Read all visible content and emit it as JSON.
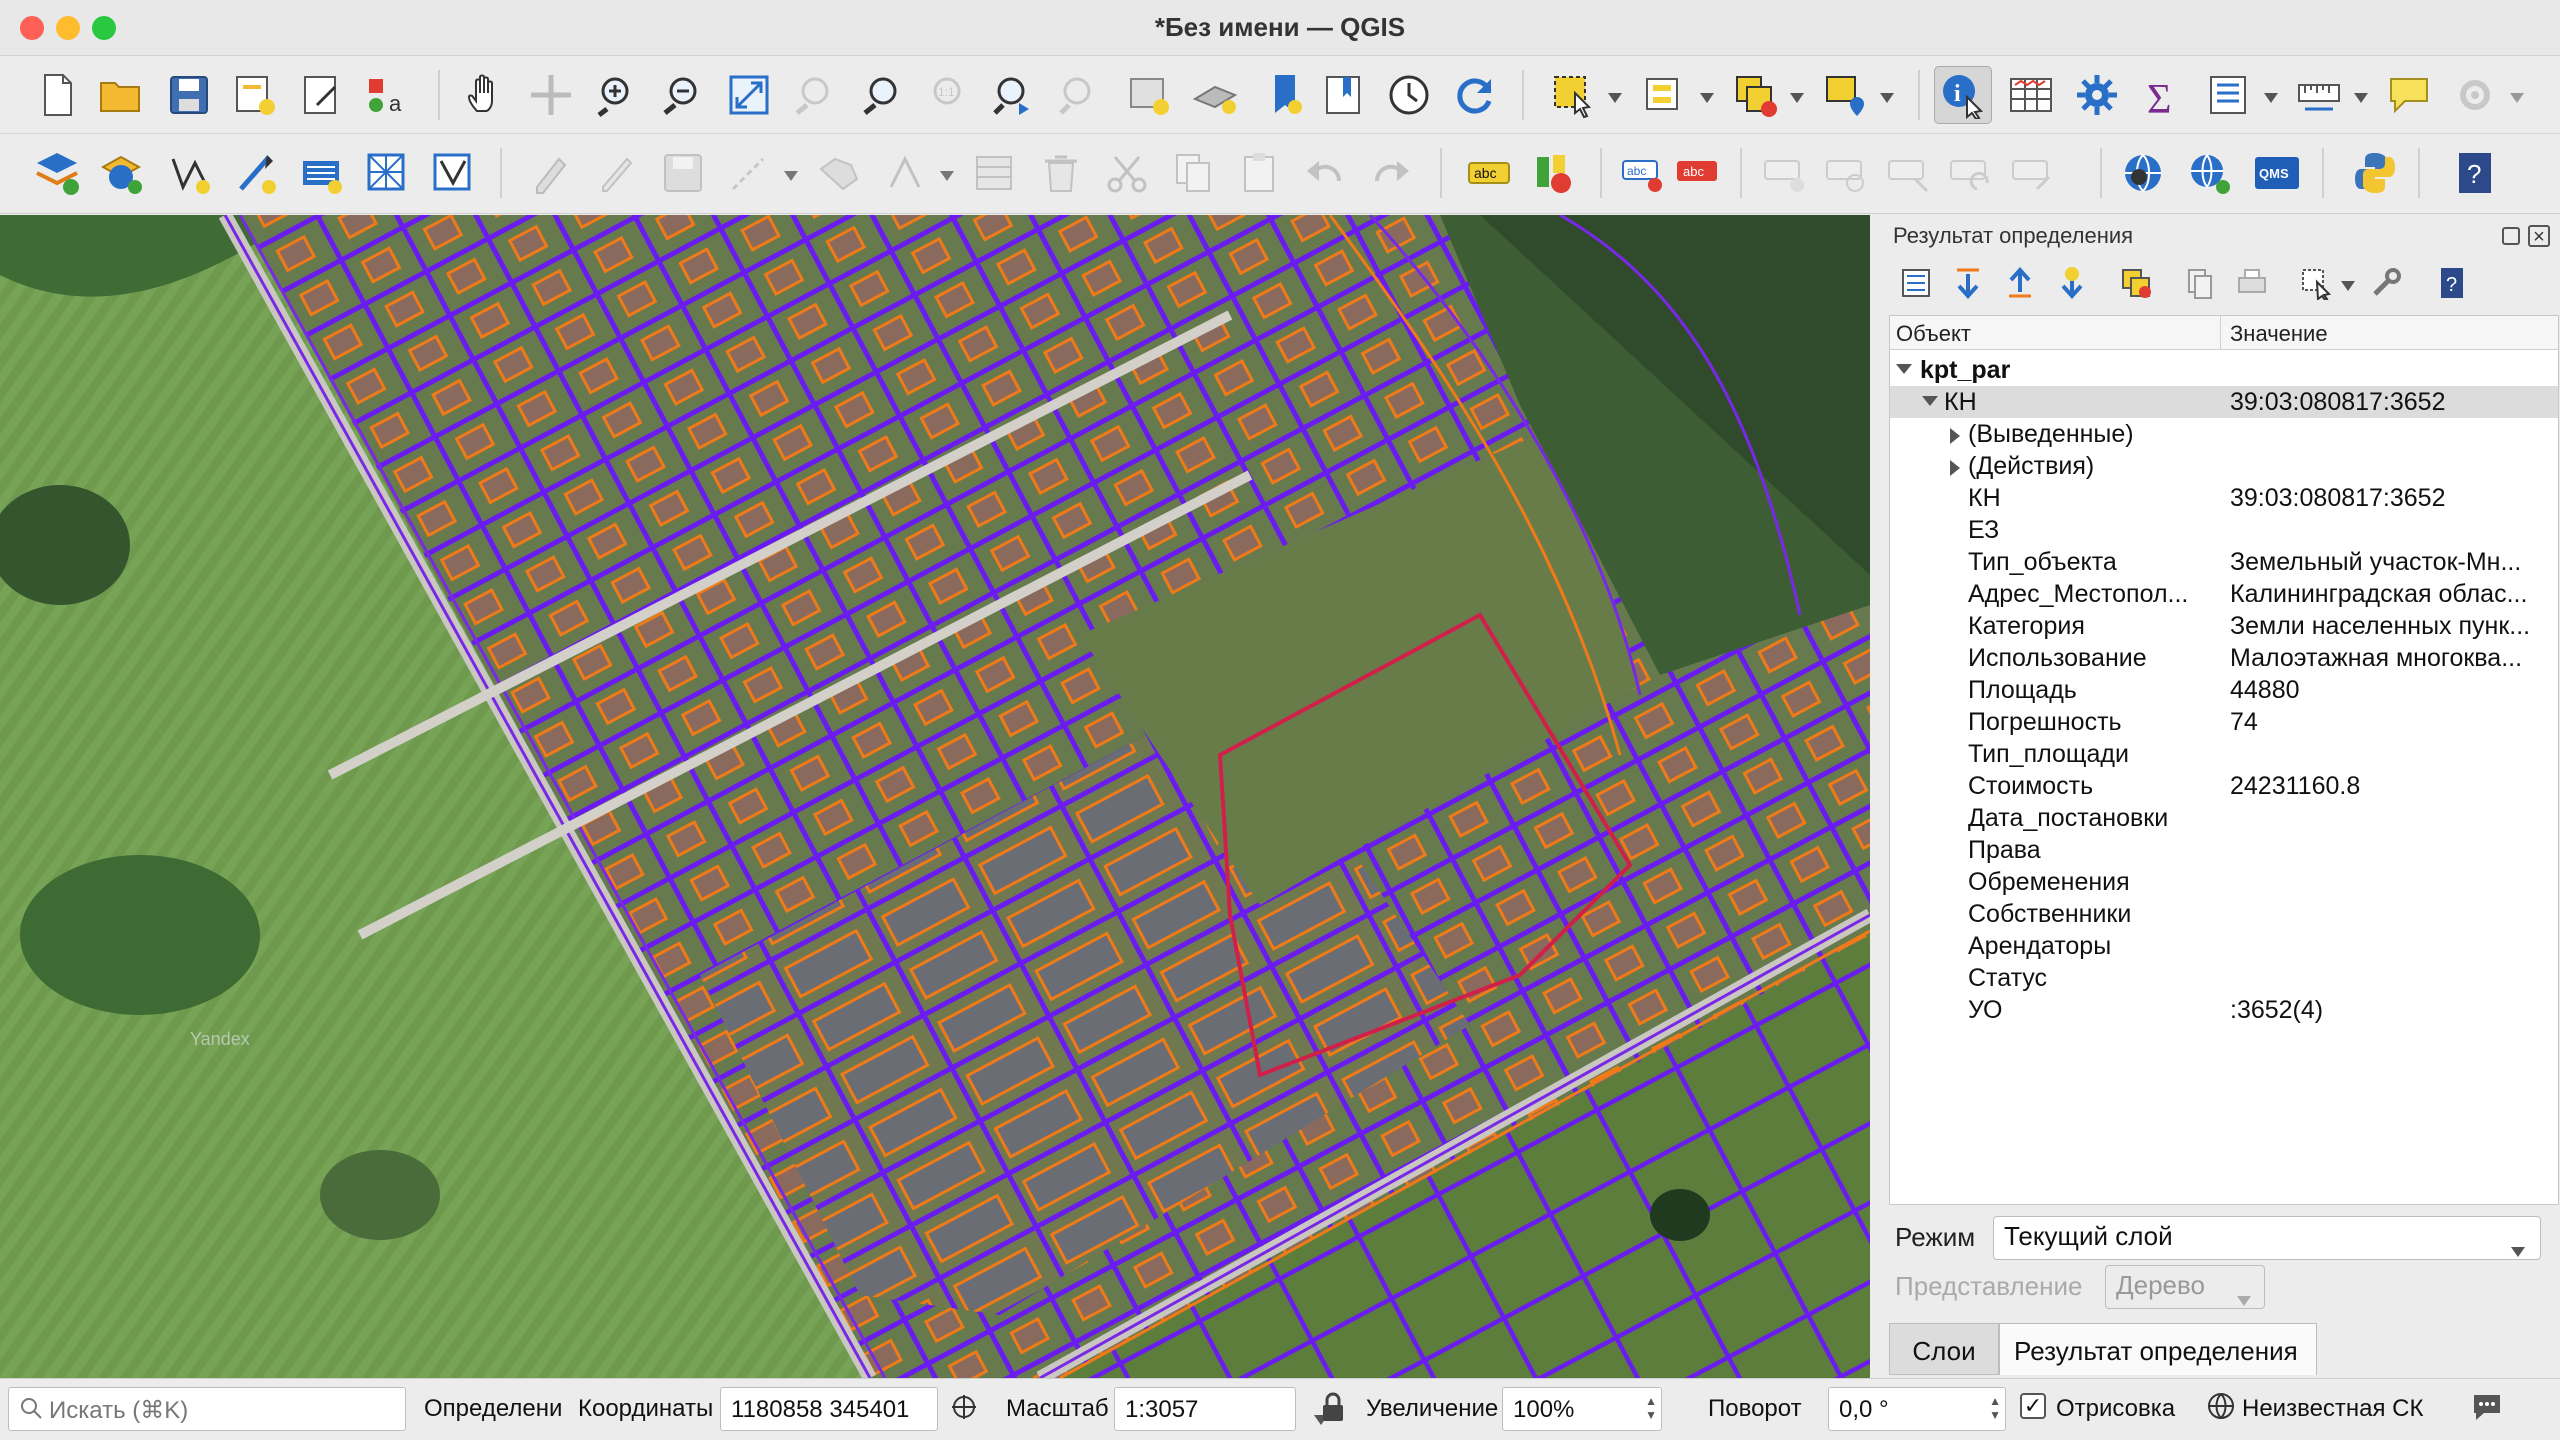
{
  "window": {
    "title": "*Без имени — QGIS"
  },
  "toolbar1": {
    "icons": [
      "new-project-icon",
      "open-project-icon",
      "save-project-icon",
      "save-as-icon",
      "print-layout-icon",
      "style-manager-icon",
      "pan-icon",
      "pan-to-selection-icon",
      "zoom-in-icon",
      "zoom-out-icon",
      "zoom-full-icon",
      "zoom-to-selection-icon",
      "zoom-to-layer-icon",
      "zoom-native-icon",
      "zoom-last-icon",
      "zoom-next-icon",
      "new-map-view-icon",
      "new-3d-view-icon",
      "new-bookmark-icon",
      "show-bookmarks-icon",
      "temporal-controller-icon",
      "refresh-icon",
      "select-features-icon",
      "select-by-value-icon",
      "deselect-icon",
      "select-location-icon",
      "identify-icon",
      "attribute-table-icon",
      "processing-toolbox-icon",
      "statistics-icon",
      "open-field-calculator-icon",
      "measure-icon",
      "annotation-icon",
      "settings-icon"
    ]
  },
  "toolbar2": {
    "icons": [
      "add-layer-icon",
      "add-vector-icon",
      "digitize-icon",
      "add-line-icon",
      "add-raster-icon",
      "add-mesh-icon",
      "add-wfs-icon",
      "toggle-editing-icon",
      "pencil-icon",
      "save-edits-icon",
      "add-feature-icon",
      "vertex-tool-icon",
      "modify-attributes-icon",
      "delete-icon",
      "cut-icon",
      "copy-icon",
      "paste-icon",
      "undo-icon",
      "redo-icon",
      "label-toolbar-icon",
      "diagram-icon",
      "label-pin-icon",
      "label-highlight-icon",
      "label-move-icon",
      "label-rotate-icon",
      "label-change-icon",
      "label-show-icon",
      "label-hide-icon",
      "quickmapservices-icon",
      "add-wms-icon",
      "qms-icon",
      "python-console-icon",
      "help-icon"
    ],
    "abc_label": "abc",
    "qms_label": "QMS"
  },
  "map": {
    "watermark": "Yandex"
  },
  "identify_panel": {
    "title": "Результат определения",
    "col_object": "Объект",
    "col_value": "Значение",
    "layer": "kpt_par",
    "feature_key": "КН",
    "feature_value": "39:03:080817:3652",
    "derived": "(Выведенные)",
    "actions": "(Действия)",
    "attributes": [
      {
        "k": "КН",
        "v": "39:03:080817:3652"
      },
      {
        "k": "ЕЗ",
        "v": ""
      },
      {
        "k": "Тип_объекта",
        "v": "Земельный участок-Мн..."
      },
      {
        "k": "Адрес_Местопол...",
        "v": "Калининградская облас..."
      },
      {
        "k": "Категория",
        "v": "Земли населенных пунк..."
      },
      {
        "k": "Использование",
        "v": "Малоэтажная многоква..."
      },
      {
        "k": "Площадь",
        "v": "44880"
      },
      {
        "k": "Погрешность",
        "v": "74"
      },
      {
        "k": "Тип_площади",
        "v": ""
      },
      {
        "k": "Стоимость",
        "v": "24231160.8"
      },
      {
        "k": "Дата_постановки",
        "v": ""
      },
      {
        "k": "Права",
        "v": ""
      },
      {
        "k": "Обременения",
        "v": ""
      },
      {
        "k": "Собственники",
        "v": ""
      },
      {
        "k": "Арендаторы",
        "v": ""
      },
      {
        "k": "Статус",
        "v": ""
      },
      {
        "k": "УО",
        "v": ":3652(4)"
      }
    ],
    "mode_label": "Режим",
    "mode_value": "Текущий слой",
    "view_label": "Представление",
    "view_value": "Дерево",
    "tab_layers": "Слои",
    "tab_identify": "Результат определения"
  },
  "statusbar": {
    "search_placeholder": "Искать (⌘K)",
    "identify_msg": "Определени",
    "coords_label": "Координаты",
    "coords_value": "1180858  345401",
    "scale_label": "Масштаб",
    "scale_value": "1:3057",
    "magnifier_label": "Увеличение",
    "magnifier_value": "100%",
    "rotation_label": "Поворот",
    "rotation_value": "0,0 °",
    "render_label": "Отрисовка",
    "crs_label": "Неизвестная СК"
  },
  "colors": {
    "parcel_purple": "#6a1cf0",
    "building_orange": "#f07a18",
    "field_green": "#6f9a4e"
  }
}
